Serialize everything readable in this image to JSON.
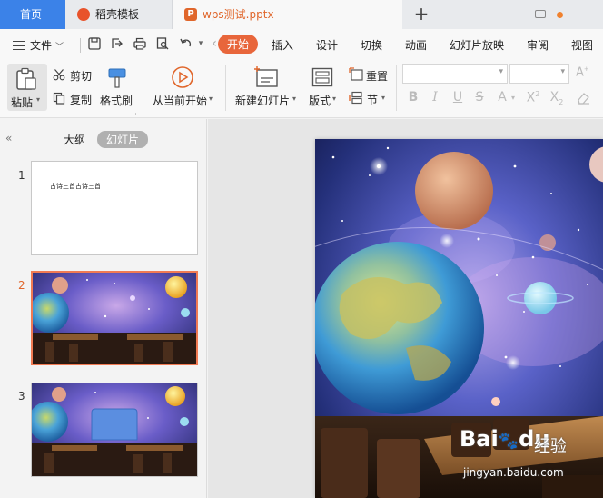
{
  "tabs": {
    "home": "首页",
    "docer": "稻壳模板",
    "document": "wps测试.pptx",
    "doc_icon": "P"
  },
  "menu": {
    "file": "文件",
    "tabs": [
      "开始",
      "插入",
      "设计",
      "切换",
      "动画",
      "幻灯片放映",
      "审阅",
      "视图"
    ],
    "active_tab": "开始"
  },
  "ribbon": {
    "paste": "粘贴",
    "cut": "剪切",
    "copy": "复制",
    "format_painter": "格式刷",
    "from_current": "从当前开始",
    "new_slide": "新建幻灯片",
    "layout": "版式",
    "reset": "重置",
    "section": "节"
  },
  "left_panel": {
    "outline_tab": "大纲",
    "slides_tab": "幻灯片",
    "slides": [
      {
        "number": "1",
        "text": "古诗三首古诗三首"
      },
      {
        "number": "2",
        "text": ""
      },
      {
        "number": "3",
        "text": ""
      }
    ],
    "selected_slide": "2"
  },
  "watermark": {
    "logo": "Bai",
    "logo_paw": "du",
    "cn": "经验",
    "url": "jingyan.baidu.com"
  },
  "colors": {
    "accent": "#e8663b",
    "home_tab": "#3b82e8",
    "selection": "#f07a53"
  }
}
